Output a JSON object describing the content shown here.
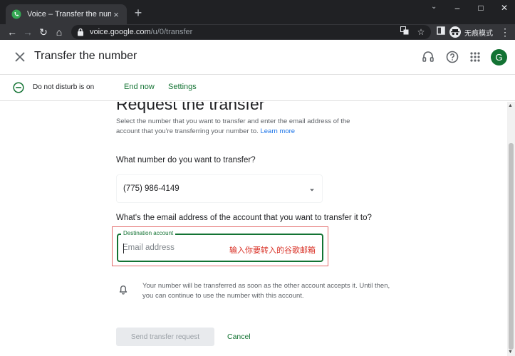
{
  "browser": {
    "tab_title": "Voice – Transfer the number",
    "tab_close": "×",
    "new_tab": "+",
    "url_host": "voice.google.com",
    "url_path": "/u/0/transfer",
    "incognito_label": "无痕模式",
    "controls": {
      "minimize": "–",
      "maximize": "□",
      "close": "✕"
    }
  },
  "app": {
    "page_title": "Transfer the number",
    "avatar_letter": "G"
  },
  "dnd": {
    "status": "Do not disturb is on",
    "end_now": "End now",
    "settings": "Settings"
  },
  "main": {
    "heading": "Request the transfer",
    "description": "Select the number that you want to transfer and enter the email address of the account that you're transferring your number to.",
    "learn_more": "Learn more",
    "question_number": "What number do you want to transfer?",
    "selected_number": "(775) 986-4149",
    "question_email": "What's the email address of the account that you want to transfer it to?",
    "destination_label": "Destination account",
    "email_placeholder": "Email address",
    "annotation": "输入你要转入的谷歌邮箱",
    "notice": "Your number will be transferred as soon as the other account accepts it. Until then, you can continue to use the number with this account.",
    "send_button": "Send transfer request",
    "cancel_button": "Cancel"
  },
  "colors": {
    "accent_green": "#137333",
    "annotation_red": "#d93025"
  },
  "icons": [
    "voice-favicon",
    "back-icon",
    "forward-icon",
    "reload-icon",
    "home-icon",
    "lock-icon",
    "translate-icon",
    "star-icon",
    "sidepanel-icon",
    "incognito-icon",
    "more-vert-icon",
    "close-icon",
    "headset-icon",
    "help-icon",
    "apps-icon",
    "dnd-icon",
    "dropdown-caret-icon",
    "bell-icon"
  ]
}
